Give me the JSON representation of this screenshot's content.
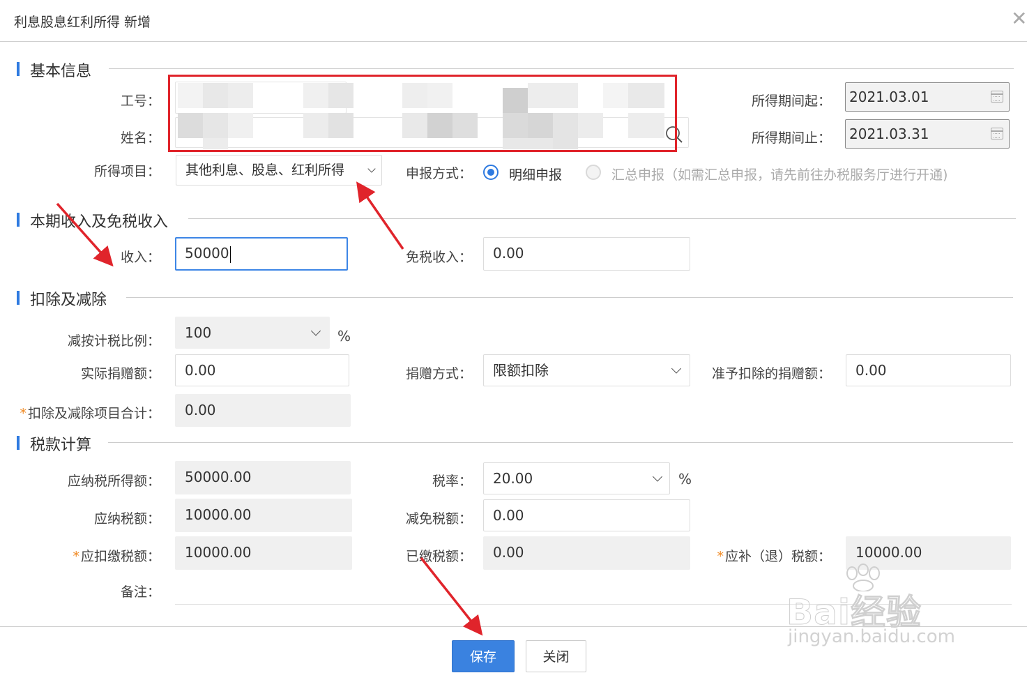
{
  "dialog": {
    "title": "利息股息红利所得 新增",
    "close_glyph": "✕"
  },
  "sections": {
    "basic": "基本信息",
    "income": "本期收入及免税收入",
    "deduction": "扣除及减除",
    "tax": "税款计算"
  },
  "basic": {
    "emp_no_label": "工号：",
    "name_label": "姓名：",
    "period_start_label": "所得期间起：",
    "period_start_value": "2021.03.01",
    "period_end_label": "所得期间止：",
    "period_end_value": "2021.03.31",
    "item_label": "所得项目：",
    "item_value": "其他利息、股息、红利所得",
    "report_label": "申报方式：",
    "report_opt1": "明细申报",
    "report_opt2": "汇总申报（如需汇总申报，请先前往办税服务厅进行开通)"
  },
  "income": {
    "income_label": "收入：",
    "income_value": "50000",
    "exempt_label": "免税收入：",
    "exempt_value": "0.00"
  },
  "deduction": {
    "ratio_label": "减按计税比例：",
    "ratio_value": "100",
    "ratio_unit": "%",
    "donation_label": "实际捐赠额：",
    "donation_value": "0.00",
    "donation_method_label": "捐赠方式：",
    "donation_method_value": "限额扣除",
    "allowed_label": "准予扣除的捐赠额：",
    "allowed_value": "0.00",
    "total_label": "扣除及减除项目合计：",
    "total_value": "0.00"
  },
  "tax": {
    "taxable_label": "应纳税所得额：",
    "taxable_value": "50000.00",
    "rate_label": "税率：",
    "rate_value": "20.00",
    "rate_unit": "%",
    "payable_label": "应纳税额：",
    "payable_value": "10000.00",
    "relief_label": "减免税额：",
    "relief_value": "0.00",
    "withhold_label": "应扣缴税额：",
    "withhold_value": "10000.00",
    "paid_label": "已缴税额：",
    "paid_value": "0.00",
    "refund_label": "应补（退）税额：",
    "refund_value": "10000.00",
    "remark_label": "备注："
  },
  "buttons": {
    "save": "保存",
    "close": "关闭"
  },
  "watermark": {
    "brand": "Bai经验",
    "url": "jingyan.baidu.com"
  },
  "colors": {
    "accent": "#3a82e0",
    "annotation": "#e0242b",
    "required": "#f08a24"
  }
}
